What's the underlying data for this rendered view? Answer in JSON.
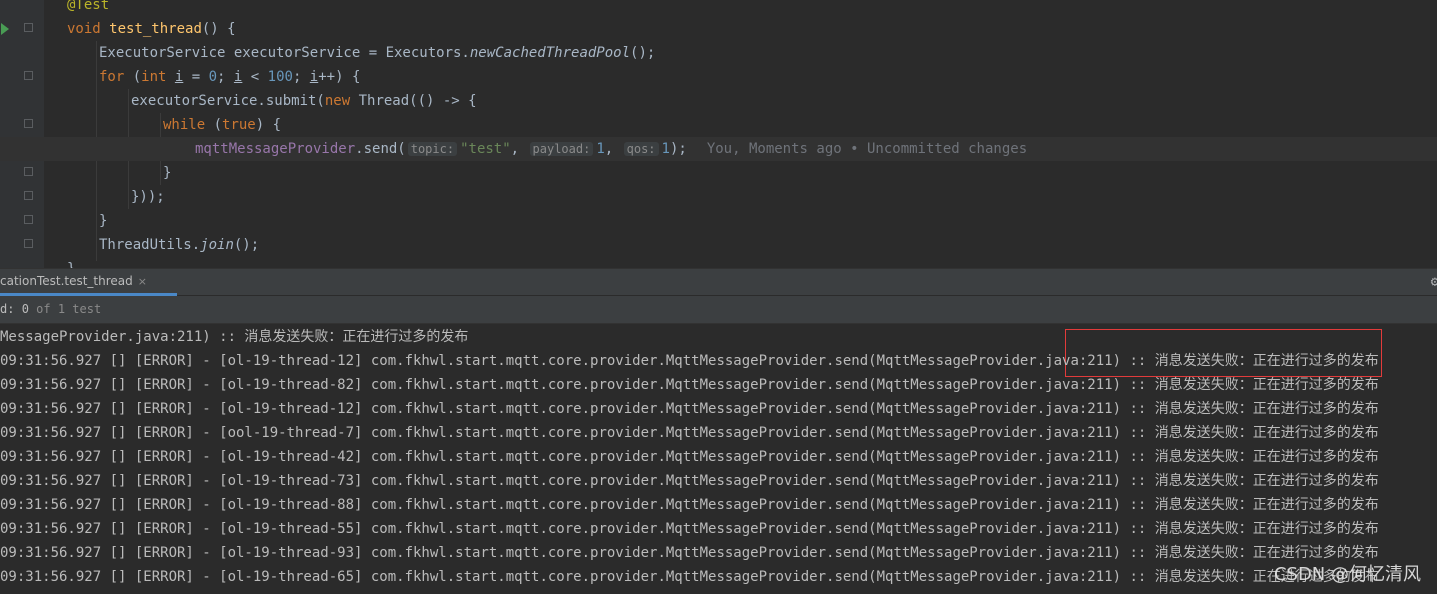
{
  "editor": {
    "lines": [
      {
        "segs": [
          [
            "ann",
            "@Test"
          ]
        ]
      },
      {
        "segs": [
          [
            "kw",
            "void "
          ],
          [
            "fn",
            "test_thread"
          ],
          [
            "",
            "() {"
          ]
        ]
      },
      {
        "segs": [
          [
            "",
            "ExecutorService executorService = Executors."
          ],
          [
            "it",
            "newCachedThreadPool"
          ],
          [
            "",
            "();"
          ]
        ]
      },
      {
        "segs": [
          [
            "kw",
            "for "
          ],
          [
            "",
            "("
          ],
          [
            "kw",
            "int "
          ],
          [
            "ul",
            "i"
          ],
          [
            "",
            " = "
          ],
          [
            "num",
            "0"
          ],
          [
            "",
            "; "
          ],
          [
            "ul",
            "i"
          ],
          [
            "",
            " < "
          ],
          [
            "num",
            "100"
          ],
          [
            "",
            "; "
          ],
          [
            "ul",
            "i"
          ],
          [
            "",
            "++) {"
          ]
        ]
      },
      {
        "segs": [
          [
            "",
            "executorService.submit("
          ],
          [
            "kw",
            "new "
          ],
          [
            "",
            "Thread(() -> {"
          ]
        ]
      },
      {
        "segs": [
          [
            "kw",
            "while "
          ],
          [
            "",
            "("
          ],
          [
            "kw",
            "true"
          ],
          [
            "",
            ") {"
          ]
        ]
      },
      {
        "segs": [
          [
            "fld",
            "mqttMessageProvider"
          ],
          [
            "",
            ".send("
          ],
          [
            "hint",
            "topic:"
          ],
          [
            "str",
            "\"test\""
          ],
          [
            "",
            ", "
          ],
          [
            "hint",
            "payload:"
          ],
          [
            "num",
            "1"
          ],
          [
            "",
            ", "
          ],
          [
            "hint",
            "qos:"
          ],
          [
            "num",
            "1"
          ],
          [
            "",
            ");"
          ],
          [
            "blame",
            "You, Moments ago • Uncommitted changes"
          ]
        ]
      },
      {
        "segs": [
          [
            "",
            "}"
          ]
        ]
      },
      {
        "segs": [
          [
            "",
            "}));"
          ]
        ]
      },
      {
        "segs": [
          [
            "",
            "}"
          ]
        ]
      },
      {
        "segs": [
          [
            "",
            "ThreadUtils."
          ],
          [
            "it",
            "join"
          ],
          [
            "",
            "();"
          ]
        ]
      },
      {
        "segs": [
          [
            "",
            "}"
          ]
        ]
      }
    ]
  },
  "run_panel": {
    "tab_label": "cationTest.test_thread",
    "close_symbol": "×",
    "status_prefix": "d: ",
    "status_count": "0",
    "status_suffix": " of 1 test"
  },
  "console": {
    "lines": [
      "MessageProvider.java:211) :: 消息发送失败：正在进行过多的发布",
      "09:31:56.927 [] [ERROR] - [ol-19-thread-12] com.fkhwl.start.mqtt.core.provider.MqttMessageProvider.send(MqttMessageProvider.java:211) :: 消息发送失败：正在进行过多的发布",
      "09:31:56.927 [] [ERROR] - [ol-19-thread-82] com.fkhwl.start.mqtt.core.provider.MqttMessageProvider.send(MqttMessageProvider.java:211) :: 消息发送失败：正在进行过多的发布",
      "09:31:56.927 [] [ERROR] - [ol-19-thread-12] com.fkhwl.start.mqtt.core.provider.MqttMessageProvider.send(MqttMessageProvider.java:211) :: 消息发送失败：正在进行过多的发布",
      "09:31:56.927 [] [ERROR] - [ool-19-thread-7] com.fkhwl.start.mqtt.core.provider.MqttMessageProvider.send(MqttMessageProvider.java:211) :: 消息发送失败：正在进行过多的发布",
      "09:31:56.927 [] [ERROR] - [ol-19-thread-42] com.fkhwl.start.mqtt.core.provider.MqttMessageProvider.send(MqttMessageProvider.java:211) :: 消息发送失败：正在进行过多的发布",
      "09:31:56.927 [] [ERROR] - [ol-19-thread-73] com.fkhwl.start.mqtt.core.provider.MqttMessageProvider.send(MqttMessageProvider.java:211) :: 消息发送失败：正在进行过多的发布",
      "09:31:56.927 [] [ERROR] - [ol-19-thread-88] com.fkhwl.start.mqtt.core.provider.MqttMessageProvider.send(MqttMessageProvider.java:211) :: 消息发送失败：正在进行过多的发布",
      "09:31:56.927 [] [ERROR] - [ol-19-thread-55] com.fkhwl.start.mqtt.core.provider.MqttMessageProvider.send(MqttMessageProvider.java:211) :: 消息发送失败：正在进行过多的发布",
      "09:31:56.927 [] [ERROR] - [ol-19-thread-93] com.fkhwl.start.mqtt.core.provider.MqttMessageProvider.send(MqttMessageProvider.java:211) :: 消息发送失败：正在进行过多的发布",
      "09:31:56.927 [] [ERROR] - [ol-19-thread-65] com.fkhwl.start.mqtt.core.provider.MqttMessageProvider.send(MqttMessageProvider.java:211) :: 消息发送失败：正在进行过多的发布"
    ],
    "watermark": "CSDN @何忆清风"
  },
  "colors": {
    "background": "#2b2b2b",
    "keyword": "#cc7832",
    "annotation": "#bbb529",
    "string": "#6a8759",
    "number": "#6897bb",
    "highlight_box": "#e23b3b",
    "tab_underline": "#4a88c7"
  },
  "icons": {
    "run": "run-gutter-icon",
    "fold": "fold-icon",
    "settings": "gear-icon"
  }
}
